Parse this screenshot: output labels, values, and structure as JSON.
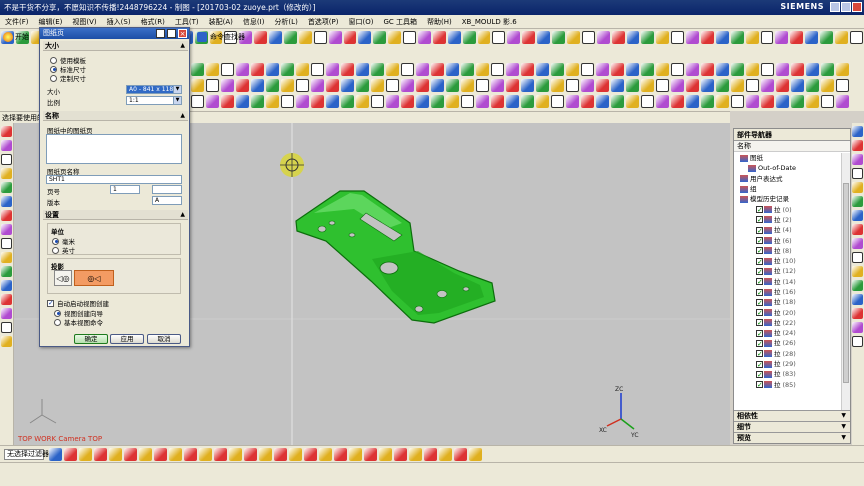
{
  "window": {
    "title": "不是干货不分享，不愿知识不传播!2448796224 - 制图 - [201703-02 zuoye.prt（修改的）]",
    "brand": "SIEMENS"
  },
  "menu": [
    "文件(F)",
    "编辑(E)",
    "视图(V)",
    "插入(S)",
    "格式(R)",
    "工具(T)",
    "装配(A)",
    "信息(I)",
    "分析(L)",
    "首选项(P)",
    "窗口(O)",
    "GC 工具箱",
    "帮助(H)",
    "XB_MOULD 影.6"
  ],
  "toolbar": {
    "start_label": "开始",
    "command_finder_label": "命令查找器"
  },
  "cue_line": "选择要使用的",
  "dialog": {
    "title": "图纸页",
    "size_group": "大小",
    "size_options": [
      "使用模板",
      "标准尺寸",
      "定制尺寸"
    ],
    "size_selected_index": 1,
    "size_label": "大小",
    "size_value": "A0 - 841 x 1189",
    "scale_label": "比例",
    "scale_value": "1:1",
    "name_group": "名称",
    "sheets_in_drawing_label": "图纸中的图纸页",
    "sheet_name_label": "图纸页名称",
    "sheet_name_value": "SHT1",
    "page_no_label": "页号",
    "page_no_value": "1",
    "page_no_value2": "",
    "revision_label": "版本",
    "revision_value": "A",
    "settings_group": "设置",
    "units_label": "单位",
    "units_options": [
      "毫米",
      "英寸"
    ],
    "units_selected_index": 0,
    "projection_label": "投影",
    "auto_view_label": "自动启动视图创建",
    "auto_view_checked": true,
    "view_create_options": [
      "视图创建向导",
      "基本视图命令"
    ],
    "view_create_selected_index": 0,
    "ok_label": "确定",
    "apply_label": "应用",
    "cancel_label": "取消"
  },
  "graphics": {
    "view_label": "TOP WORK Camera TOP",
    "model_color": "#2fc02f",
    "background_color": "#c3c3c3",
    "triad_labels": [
      "ZC",
      "YC",
      "XC"
    ]
  },
  "navigator": {
    "title": "部件导航器",
    "column_header": "名称",
    "top_rows": [
      {
        "label": "图纸"
      },
      {
        "label": "Out-of-Date"
      },
      {
        "label": "用户表达式"
      },
      {
        "label": "组"
      },
      {
        "label": "模型历史记录"
      }
    ],
    "history_items": [
      "(0)",
      "(2)",
      "(4)",
      "(6)",
      "(8)",
      "(10)",
      "(12)",
      "(14)",
      "(16)",
      "(18)",
      "(20)",
      "(22)",
      "(24)",
      "(26)",
      "(28)",
      "(29)",
      "(83)",
      "(85)"
    ],
    "history_prefix": "拉",
    "panels": [
      "相依性",
      "细节",
      "预览"
    ]
  },
  "bottom": {
    "filter_label": "无选择过滤器"
  }
}
